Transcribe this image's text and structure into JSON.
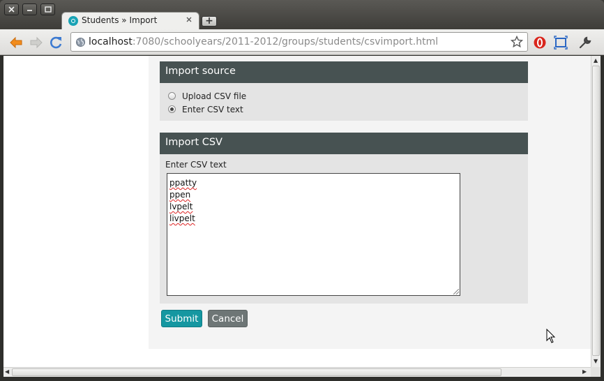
{
  "window": {
    "controls": {
      "close": "✕",
      "minimize": "–",
      "maximize": "□"
    }
  },
  "tab": {
    "title": "Students » Import",
    "favicon": "schooltool-icon",
    "new_tab_label": "+"
  },
  "toolbar": {
    "url_host": "localhost",
    "url_path": ":7080/schoolyears/2011-2012/groups/students/csvimport.html",
    "icons": [
      "back-arrow-icon",
      "forward-arrow-icon",
      "reload-icon",
      "globe-icon",
      "bookmark-star-icon",
      "opera-extension-icon",
      "screen-capture-icon",
      "wrench-menu-icon"
    ]
  },
  "import_source": {
    "heading": "Import source",
    "options": [
      {
        "label": "Upload CSV file",
        "checked": false
      },
      {
        "label": "Enter CSV text",
        "checked": true
      }
    ]
  },
  "import_csv": {
    "heading": "Import CSV",
    "field_label": "Enter CSV text",
    "lines": [
      "ppatty",
      "ppen",
      "lvpelt",
      "livpelt"
    ]
  },
  "actions": {
    "submit_label": "Submit",
    "cancel_label": "Cancel"
  },
  "colors": {
    "panel_header": "#475252",
    "submit": "#1597a1",
    "cancel": "#6e7676",
    "panel_body": "#e4e4e4"
  }
}
